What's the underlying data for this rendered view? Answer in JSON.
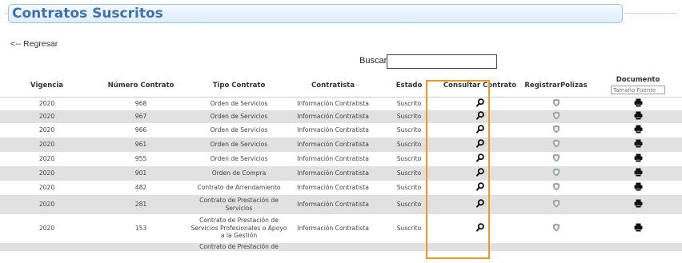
{
  "section": {
    "title": "Contratos Suscritos"
  },
  "nav": {
    "back_label": "<-- Regresar"
  },
  "search": {
    "label": "Buscar:",
    "value": ""
  },
  "table": {
    "headers": {
      "vigencia": "Vigencia",
      "numero": "Número Contrato",
      "tipo": "Tipo Contrato",
      "contratista": "Contratista",
      "estado": "Estado",
      "consultar": "Consultar Contrato",
      "polizas": "RegistrarPolizas",
      "documento": "Documento"
    },
    "font_size_placeholder": "Tamaño Fuente",
    "rows": [
      {
        "vigencia": "2020",
        "numero": "968",
        "tipo": "Orden de Servicios",
        "contratista": "Información Contratista",
        "estado": "Suscrito"
      },
      {
        "vigencia": "2020",
        "numero": "967",
        "tipo": "Orden de Servicios",
        "contratista": "Información Contratista",
        "estado": "Suscrito"
      },
      {
        "vigencia": "2020",
        "numero": "966",
        "tipo": "Orden de Servicios",
        "contratista": "Información Contratista",
        "estado": "Suscrito"
      },
      {
        "vigencia": "2020",
        "numero": "961",
        "tipo": "Orden de Servicios",
        "contratista": "Información Contratista",
        "estado": "Suscrito"
      },
      {
        "vigencia": "2020",
        "numero": "955",
        "tipo": "Orden de Servicios",
        "contratista": "Información Contratista",
        "estado": "Suscrito"
      },
      {
        "vigencia": "2020",
        "numero": "901",
        "tipo": "Orden de Compra",
        "contratista": "Información Contratista",
        "estado": "Suscrito"
      },
      {
        "vigencia": "2020",
        "numero": "482",
        "tipo": "Contrato de Arrendamiento",
        "contratista": "Información Contratista",
        "estado": "Suscrito"
      },
      {
        "vigencia": "2020",
        "numero": "281",
        "tipo": "Contrato de Prestación de Servicios",
        "contratista": "Información Contratista",
        "estado": "Suscrito"
      },
      {
        "vigencia": "2020",
        "numero": "153",
        "tipo": "Contrato de Prestación de Servicios Profesionales o Apoyo a la Gestión",
        "contratista": "Información Contratista",
        "estado": "Suscrito"
      },
      {
        "vigencia": "",
        "numero": "",
        "tipo": "Contrato de Prestación de",
        "contratista": "",
        "estado": ""
      }
    ]
  },
  "icons": {
    "consultar": "search-icon",
    "polizas": "shield-icon",
    "documento": "print-icon"
  },
  "colors": {
    "title": "#3f72b3",
    "highlight": "#f0962b",
    "row_alt": "#e1e1e1"
  }
}
